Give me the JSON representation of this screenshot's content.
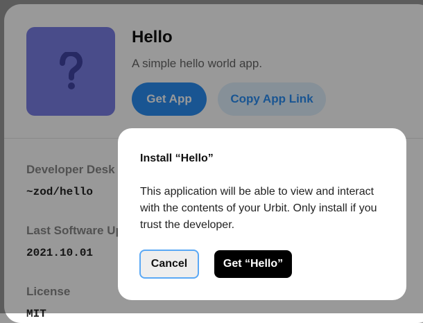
{
  "app": {
    "title": "Hello",
    "description": "A simple hello world app.",
    "tile_icon": "question-mark-icon",
    "tile_color": "#7b7fe6",
    "get_app_label": "Get App",
    "copy_link_label": "Copy App Link"
  },
  "details": [
    {
      "label": "Developer Desk",
      "value": "~zod/hello"
    },
    {
      "label": "Last Software Updated",
      "value": "2021.10.01"
    },
    {
      "label": "License",
      "value": "MIT"
    }
  ],
  "dialog": {
    "title": "Install “Hello”",
    "body": "This application will be able to view and interact with the contents of your Urbit. Only install if you trust the developer.",
    "cancel_label": "Cancel",
    "confirm_label": "Get “Hello”"
  },
  "colors": {
    "primary": "#2b8ef4",
    "secondary_bg": "#dff0fe",
    "overlay": "rgba(0,0,0,0.4)"
  }
}
